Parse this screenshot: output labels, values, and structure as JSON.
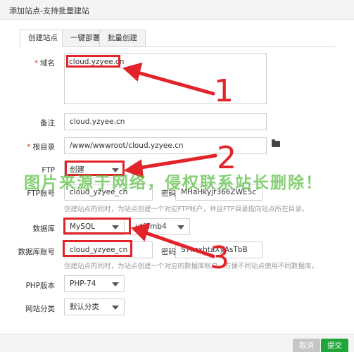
{
  "window": {
    "title": "添加站点-支持批量建站"
  },
  "tabs": [
    {
      "label": "创建站点",
      "active": true
    },
    {
      "label": "一键部署",
      "active": false
    },
    {
      "label": "批量创建",
      "active": false
    }
  ],
  "form": {
    "domain": {
      "label": "域名",
      "required": true,
      "value": "cloud.yzyee.cn"
    },
    "remark": {
      "label": "备注",
      "value": "cloud.yzyee.cn"
    },
    "rootdir": {
      "label": "根目录",
      "required": true,
      "value": "/www/wwwroot/cloud.yzyee.cn",
      "icon": "folder-icon"
    },
    "ftp": {
      "label": "FTP",
      "selected": "创建"
    },
    "ftp_account": {
      "label": "FTP账号",
      "value": "cloud_yzyee_cn",
      "password_label": "密码",
      "password_value": "MHaHkyjr366ZWE5c",
      "hint": "创建站点的同时，为站点创建一个对应FTP帐户，并且FTP目录指向站点所在目录。"
    },
    "database": {
      "label": "数据库",
      "selected": "MySQL",
      "charset": "utf8mb4"
    },
    "db_account": {
      "label": "数据库账号",
      "value": "cloud_yzyee_cn",
      "password_label": "密码",
      "password_value": "SYkcxhtaXyAsTbB",
      "hint": "创建站点的同时，为站点创建一个对应的数据库帐户，方便不同站点使用不同数据库。"
    },
    "php_version": {
      "label": "PHP版本",
      "selected": "PHP-74"
    },
    "site_category": {
      "label": "网站分类",
      "selected": "默认分类"
    }
  },
  "footer": {
    "cancel_label": "取消",
    "submit_label": "提交"
  },
  "annotations": {
    "watermark": "图片来源于网络，侵权联系站长删除！",
    "numbers": [
      "1",
      "2",
      "3"
    ],
    "color": "#e2232a"
  }
}
